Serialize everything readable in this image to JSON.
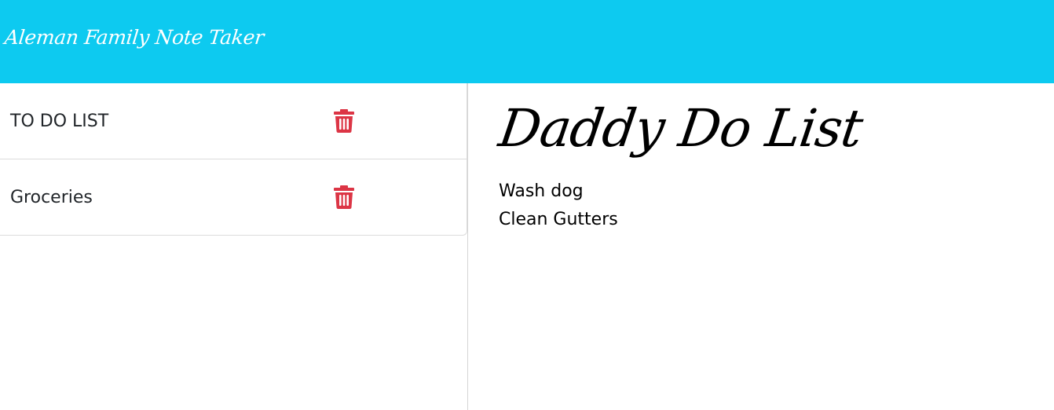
{
  "app": {
    "title": "Aleman Family Note Taker"
  },
  "colors": {
    "navbar": "#0dcaf0",
    "delete_icon": "#dc3545"
  },
  "sidebar": {
    "notes": [
      {
        "title": "TO DO LIST",
        "delete_icon": "trash-icon"
      },
      {
        "title": "Groceries",
        "delete_icon": "trash-icon"
      }
    ]
  },
  "main": {
    "note_title": "Daddy Do List",
    "note_lines": [
      "Wash dog",
      "Clean Gutters"
    ]
  }
}
